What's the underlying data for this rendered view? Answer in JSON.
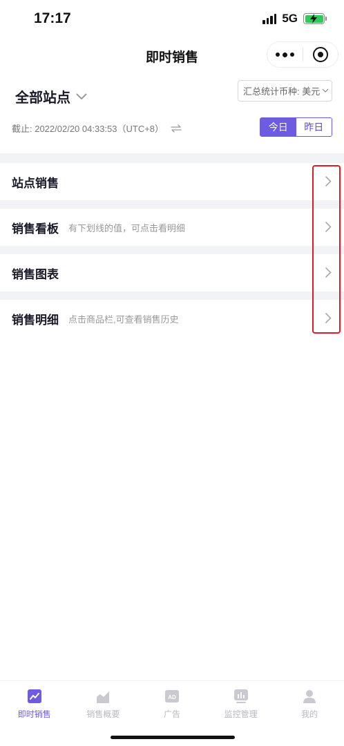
{
  "status_bar": {
    "time": "17:17",
    "network": "5G"
  },
  "nav": {
    "title": "即时销售"
  },
  "site_selector": {
    "label": "全部站点"
  },
  "currency_selector": {
    "label": "汇总统计币种: 美元"
  },
  "as_of": {
    "text": "截止: 2022/02/20 04:33:53（UTC+8）"
  },
  "day_toggle": {
    "today": "今日",
    "yesterday": "昨日",
    "selected": "今日"
  },
  "menu": [
    {
      "title": "站点销售",
      "hint": ""
    },
    {
      "title": "销售看板",
      "hint": "有下划线的值，可点击看明细"
    },
    {
      "title": "销售图表",
      "hint": ""
    },
    {
      "title": "销售明细",
      "hint": "点击商品栏,可查看销售历史"
    }
  ],
  "tabs": [
    {
      "label": "即时销售",
      "icon": "chart-line-icon",
      "active": true
    },
    {
      "label": "销售概要",
      "icon": "area-chart-icon",
      "active": false
    },
    {
      "label": "广告",
      "icon": "ad-icon",
      "active": false
    },
    {
      "label": "监控管理",
      "icon": "monitor-bars-icon",
      "active": false
    },
    {
      "label": "我的",
      "icon": "person-icon",
      "active": false
    }
  ],
  "colors": {
    "accent": "#6e5ce0",
    "highlight": "#e01b24",
    "battery": "#34c759"
  }
}
